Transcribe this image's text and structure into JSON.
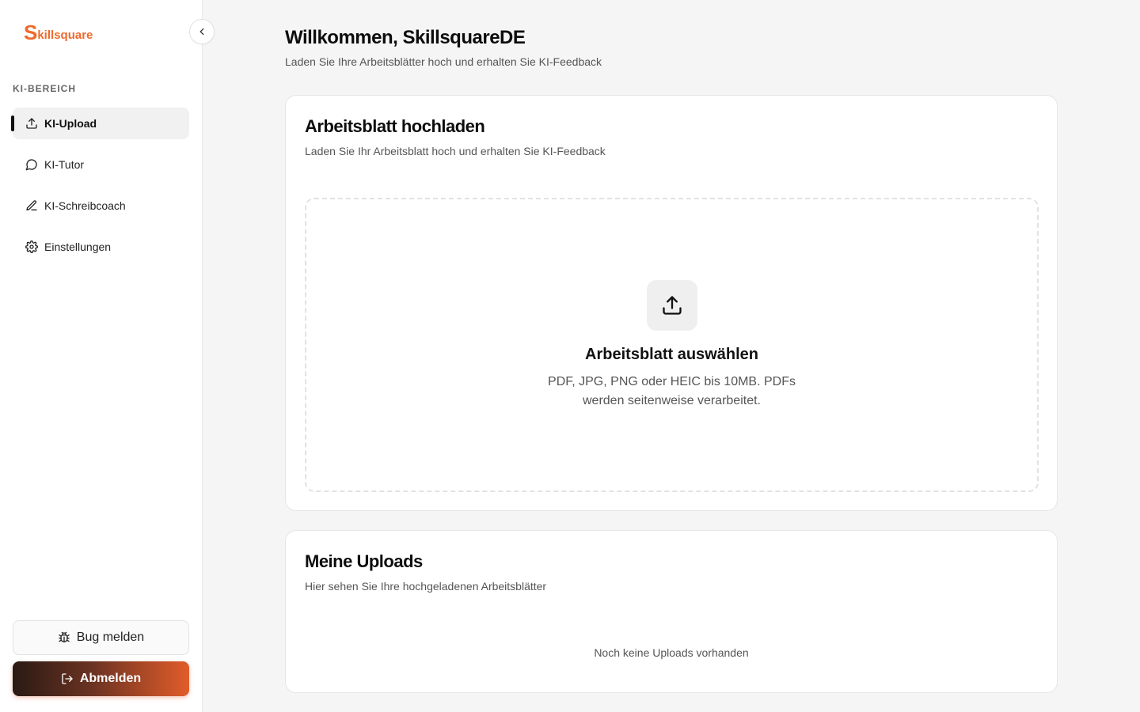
{
  "brand": {
    "logo_first": "S",
    "logo_rest": "killsquare",
    "accent": "#ef6a2a"
  },
  "sidebar": {
    "section_label": "KI-BEREICH",
    "items": [
      {
        "label": "KI-Upload",
        "icon": "upload-icon",
        "active": true
      },
      {
        "label": "KI-Tutor",
        "icon": "chat-bubble-icon",
        "active": false
      },
      {
        "label": "KI-Schreibcoach",
        "icon": "pencil-icon",
        "active": false
      },
      {
        "label": "Einstellungen",
        "icon": "gear-icon",
        "active": false
      }
    ],
    "bug_label": "Bug melden",
    "logout_label": "Abmelden"
  },
  "header": {
    "title": "Willkommen, SkillsquareDE",
    "subtitle": "Laden Sie Ihre Arbeitsblätter hoch und erhalten Sie KI-Feedback"
  },
  "upload_card": {
    "title": "Arbeitsblatt hochladen",
    "subtitle": "Laden Sie Ihr Arbeitsblatt hoch und erhalten Sie KI-Feedback",
    "dropzone_title": "Arbeitsblatt auswählen",
    "dropzone_desc": "PDF, JPG, PNG oder HEIC bis 10MB. PDFs werden seitenweise verarbeitet."
  },
  "uploads_card": {
    "title": "Meine Uploads",
    "subtitle": "Hier sehen Sie Ihre hochgeladenen Arbeitsblätter",
    "empty_text": "Noch keine Uploads vorhanden"
  }
}
